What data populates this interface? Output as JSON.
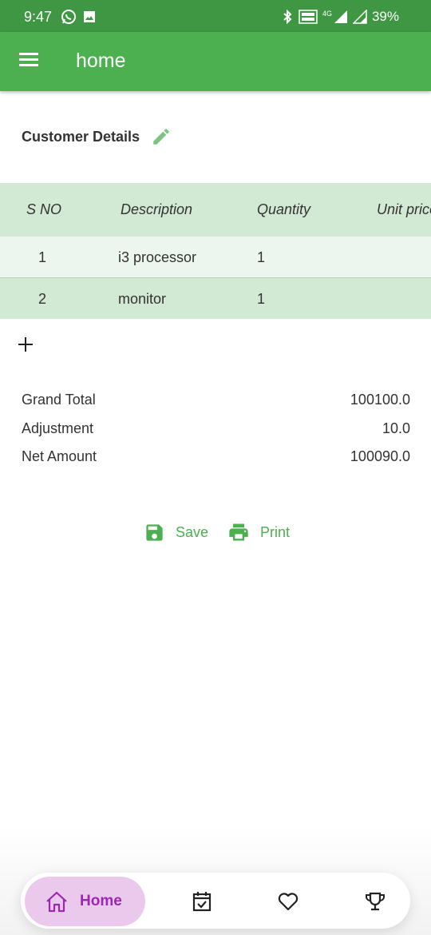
{
  "status_bar": {
    "time": "9:47",
    "network": "4G",
    "battery": "39%"
  },
  "app_bar": {
    "title": "home",
    "menu_icon": "hamburger-menu-icon"
  },
  "customer": {
    "title": "Customer Details",
    "edit_icon": "pencil-icon"
  },
  "table": {
    "headers": [
      "S NO",
      "Description",
      "Quantity",
      "Unit price"
    ],
    "rows": [
      {
        "sno": "1",
        "description": "i3 processor",
        "quantity": "1"
      },
      {
        "sno": "2",
        "description": "monitor",
        "quantity": "1"
      }
    ],
    "header_bg": "#d2e9d3",
    "odd_bg": "#edf6ee"
  },
  "add_icon": "plus-icon",
  "totals": {
    "grand_total_label": "Grand Total",
    "grand_total_value": "100100.0",
    "adjustment_label": "Adjustment",
    "adjustment_value": "10.0",
    "net_amount_label": "Net Amount",
    "net_amount_value": "100090.0"
  },
  "actions": {
    "save_label": "Save",
    "print_label": "Print"
  },
  "bottom_nav": {
    "home_label": "Home",
    "items": [
      "home-icon",
      "calendar-check-icon",
      "heart-icon",
      "trophy-icon"
    ],
    "active_color": "#9c27b0",
    "active_bg": "#ebc9ed"
  },
  "colors": {
    "primary": "#4caf50",
    "status_bar": "#3f9643"
  }
}
